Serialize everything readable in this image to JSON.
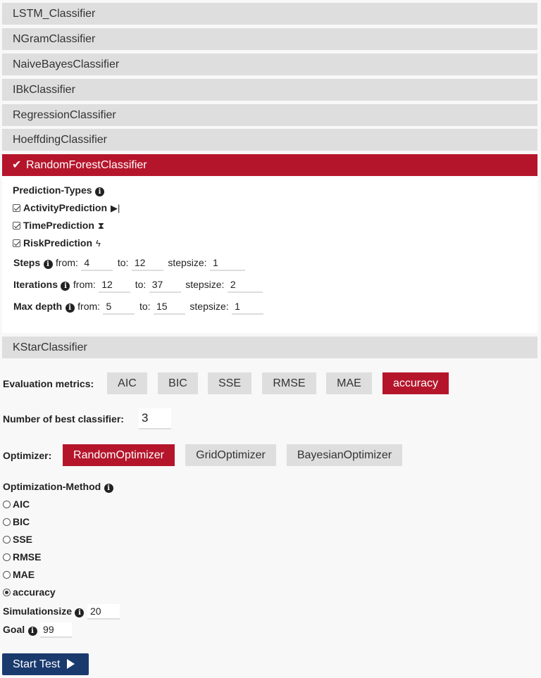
{
  "classifiers": [
    {
      "label": "LSTM_Classifier"
    },
    {
      "label": "NGramClassifier"
    },
    {
      "label": "NaiveBayesClassifier"
    },
    {
      "label": "IBkClassifier"
    },
    {
      "label": "RegressionClassifier"
    },
    {
      "label": "HoeffdingClassifier"
    },
    {
      "label": "RandomForestClassifier",
      "active": true
    },
    {
      "label": "KStarClassifier"
    }
  ],
  "panel": {
    "prediction_types_label": "Prediction-Types",
    "predictions": [
      {
        "label": "ActivityPrediction",
        "checked": true,
        "icon": "step-forward-icon"
      },
      {
        "label": "TimePrediction",
        "checked": true,
        "icon": "hourglass-icon"
      },
      {
        "label": "RiskPrediction",
        "checked": true,
        "icon": "bolt-icon"
      }
    ],
    "from_label": "from:",
    "to_label": "to:",
    "stepsize_label": "stepsize:",
    "params": [
      {
        "label": "Steps",
        "from": "4",
        "to": "12",
        "stepsize": "1"
      },
      {
        "label": "Iterations",
        "from": "12",
        "to": "37",
        "stepsize": "2"
      },
      {
        "label": "Max depth",
        "from": "5",
        "to": "15",
        "stepsize": "1"
      }
    ]
  },
  "metrics": {
    "label": "Evaluation metrics:",
    "items": [
      "AIC",
      "BIC",
      "SSE",
      "RMSE",
      "MAE",
      "accuracy"
    ],
    "active": "accuracy"
  },
  "best": {
    "label": "Number of best classifier:",
    "value": "3"
  },
  "optimizer": {
    "label": "Optimizer:",
    "items": [
      "RandomOptimizer",
      "GridOptimizer",
      "BayesianOptimizer"
    ],
    "active": "RandomOptimizer"
  },
  "method": {
    "label": "Optimization-Method",
    "options": [
      "AIC",
      "BIC",
      "SSE",
      "RMSE",
      "MAE",
      "accuracy"
    ],
    "selected": "accuracy"
  },
  "simulation": {
    "label": "Simulationsize",
    "value": "20"
  },
  "goal": {
    "label": "Goal",
    "value": "99"
  },
  "start_label": "Start Test",
  "colors": {
    "accent": "#b5152b",
    "button": "#dedede",
    "primary": "#1a3a6e"
  }
}
